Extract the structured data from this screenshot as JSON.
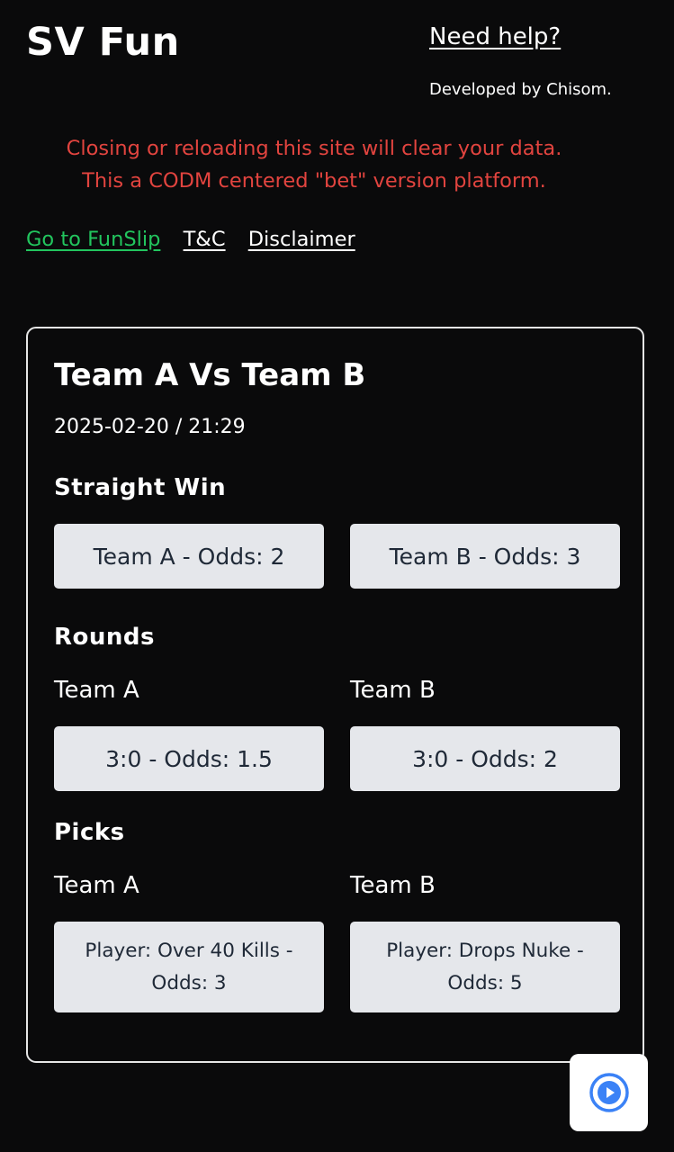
{
  "header": {
    "brand": "SV Fun",
    "help_link": "Need help?",
    "developer_credit": "Developed by Chisom."
  },
  "notice": {
    "line1": "Closing or reloading this site will clear your data.",
    "line2": "This a CODM centered \"bet\" version platform."
  },
  "nav": {
    "funslip": "Go to FunSlip",
    "terms": "T&C",
    "disclaimer": "Disclaimer"
  },
  "match": {
    "title": "Team A Vs Team B",
    "datetime": "2025-02-20 / 21:29",
    "straight_win": {
      "heading": "Straight Win",
      "options": [
        "Team A - Odds: 2",
        "Team B - Odds: 3"
      ]
    },
    "rounds": {
      "heading": "Rounds",
      "team_a_label": "Team A",
      "team_b_label": "Team B",
      "team_a_option": "3:0 - Odds: 1.5",
      "team_b_option": "3:0 - Odds: 2"
    },
    "picks": {
      "heading": "Picks",
      "team_a_label": "Team A",
      "team_b_label": "Team B",
      "team_a_option": "Player: Over 40 Kills - Odds: 3",
      "team_b_option": "Player: Drops Nuke - Odds: 5"
    }
  },
  "floating_button": {
    "icon": "play-circle-icon",
    "accent_color": "#3b82f6"
  },
  "colors": {
    "background": "#0a0a0b",
    "warning": "#e2443f",
    "link_green": "#22c55e",
    "option_bg": "#e5e7eb"
  }
}
